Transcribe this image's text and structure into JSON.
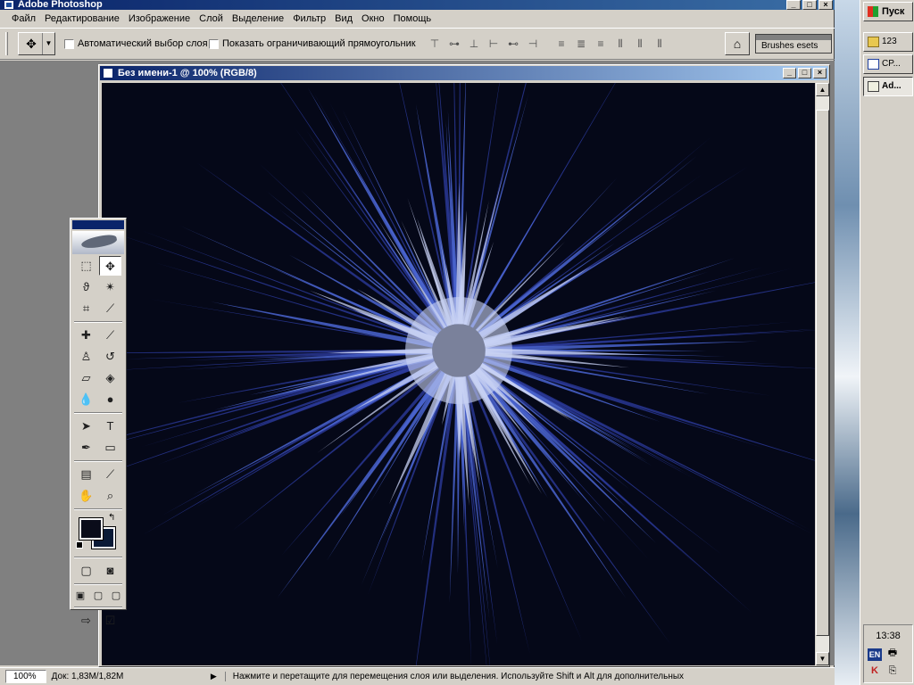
{
  "app": {
    "title": "Adobe Photoshop",
    "window_buttons": [
      "_",
      "□",
      "×"
    ]
  },
  "menu": [
    "Файл",
    "Редактирование",
    "Изображение",
    "Слой",
    "Выделение",
    "Фильтр",
    "Вид",
    "Окно",
    "Помощь"
  ],
  "options_bar": {
    "auto_select_label": "Автоматический выбор слоя",
    "auto_select_checked": false,
    "show_bounds_label": "Показать ограничивающий прямоугольник",
    "show_bounds_checked": false,
    "brushes_tab_label": "Brushes  esets"
  },
  "document": {
    "title": "Без имени-1 @ 100% (RGB/8)",
    "colors": {
      "canvas_bg": "#050818",
      "spikes_dark": "#2a3a9a",
      "spikes_mid": "#4a64d0",
      "spikes_light": "#c8d2f4"
    }
  },
  "toolbox": {
    "foreground_color": "#0a0c1a",
    "background_color": "#0a1a36"
  },
  "status": {
    "zoom": "100%",
    "doc_info": "Док: 1,83M/1,82M",
    "message": "Нажмите и перетащите для перемещения слоя или выделения. Используйте Shift и Alt для дополнительных"
  },
  "taskbar": {
    "start_label": "Пуск",
    "items": [
      {
        "label": "123",
        "icon": "folder-icon",
        "active": false
      },
      {
        "label": "CP...",
        "icon": "document-icon",
        "active": false
      },
      {
        "label": "Ad...",
        "icon": "photoshop-icon",
        "active": true
      }
    ],
    "clock": "13:38",
    "language": "EN"
  }
}
